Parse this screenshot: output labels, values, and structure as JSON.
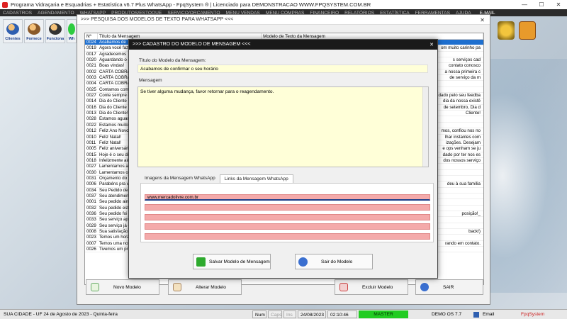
{
  "app": {
    "title": "Programa Vidraçaria e Esquadrias + Estatística v6.7 Plus WhatsApp - FpqSystem ® | Licenciado para  DEMONSTRACAO WWW.FPQSYSTEM.COM.BR",
    "controls": [
      "—",
      "☐",
      "✕"
    ]
  },
  "menu": {
    "items": [
      "CADASTROS",
      "AGENDAMENTO",
      "WHATSAPP",
      "PRODUTOS/ESTOQUE",
      "SERVIÇO/ORÇAMENTO",
      "MENU VENDAS",
      "MENU COMPRAS",
      "FINANCEIRO",
      "RELATÓRIOS",
      "ESTATÍSTICA",
      "FERRAMENTAS",
      "AJUDA"
    ],
    "email": "E-MAIL"
  },
  "toolbar": {
    "buttons": [
      {
        "label": "Clientes",
        "icon": "clients-icon"
      },
      {
        "label": "Fornece",
        "icon": "suppliers-icon"
      },
      {
        "label": "Funciona",
        "icon": "employees-icon"
      },
      {
        "label": "Wh",
        "icon": "whatsapp-icon"
      }
    ]
  },
  "search_window": {
    "title": ">>> PESQUISA DOS MODELOS DE TEXTO PARA WHATSAPP <<<",
    "close": "✕",
    "columns": [
      "Nº",
      "Título da Mensagem",
      "Modelo de Texto da Mensagem"
    ],
    "rows": [
      {
        "n": "0024",
        "title": "Acabamos de",
        "text": "",
        "selected": true
      },
      {
        "n": "0019",
        "title": "Agora você faz",
        "text": "om muito carinho pa"
      },
      {
        "n": "0017",
        "title": "Agradecemos",
        "text": ""
      },
      {
        "n": "0020",
        "title": "Aguardando o s",
        "text": "s serviços cad"
      },
      {
        "n": "0021",
        "title": "Boas vindas!",
        "text": "contato conosco"
      },
      {
        "n": "0002",
        "title": "CARTA COBRAN",
        "text": "a nossa primeira c"
      },
      {
        "n": "0003",
        "title": "CARTA COBRAN",
        "text": "de serviço da m"
      },
      {
        "n": "0004",
        "title": "CARTA COBRAN",
        "text": ""
      },
      {
        "n": "0025",
        "title": "Contamos com",
        "text": ""
      },
      {
        "n": "0027",
        "title": "Conte sempre c",
        "text": "dado pelo seu feedba"
      },
      {
        "n": "0014",
        "title": "Dia do Cliente",
        "text": "dia da nossa existê"
      },
      {
        "n": "0016",
        "title": "Dia do Cliente",
        "text": "de setembro, Dia d"
      },
      {
        "n": "0013",
        "title": "Dia do Cliente!",
        "text": "Cliente!"
      },
      {
        "n": "0028",
        "title": "Estamos aguard",
        "text": ""
      },
      {
        "n": "0022",
        "title": "Estamos muito f",
        "text": ""
      },
      {
        "n": "0012",
        "title": "Feliz Ano Novo!",
        "text": "mos, confiou nos no"
      },
      {
        "n": "0010",
        "title": "Feliz Natal!",
        "text": "lhar instantes com"
      },
      {
        "n": "0011",
        "title": "Feliz Natal!",
        "text": "izações. Desejam"
      },
      {
        "n": "0005",
        "title": "Feliz aniversário",
        "text": "e ops venham se ju"
      },
      {
        "n": "0015",
        "title": "Hoje é o seu di",
        "text": "dado por ter nos es"
      },
      {
        "n": "0018",
        "title": "Infelizmente ainc",
        "text": "dos nossos serviço"
      },
      {
        "n": "0027",
        "title": "Lamentamos a s",
        "text": ""
      },
      {
        "n": "0030",
        "title": "Lamentamos o d",
        "text": ""
      },
      {
        "n": "0031",
        "title": "Orçamento do s",
        "text": ""
      },
      {
        "n": "0006",
        "title": "Parabéns pra vo",
        "text": "deu à sua família"
      },
      {
        "n": "0034",
        "title": "Seu Pedido de V",
        "text": ""
      },
      {
        "n": "0037",
        "title": "Seu atendiment",
        "text": ""
      },
      {
        "n": "0001",
        "title": "Seu pedido ainc",
        "text": ""
      },
      {
        "n": "0032",
        "title": "Seu pedido está",
        "text": ""
      },
      {
        "n": "0036",
        "title": "Seu pedido foi D",
        "text": "posição!_"
      },
      {
        "n": "0033",
        "title": "Seu serviço apr",
        "text": ""
      },
      {
        "n": "0029",
        "title": "Seu serviço já e",
        "text": ""
      },
      {
        "n": "0008",
        "title": "Sua satisfação é",
        "text": "back!)"
      },
      {
        "n": "0023",
        "title": "Temos um horá",
        "text": ""
      },
      {
        "n": "0007",
        "title": "Temos uma noti",
        "text": "rando em contato."
      },
      {
        "n": "0026",
        "title": "Tivemos um pro",
        "text": ""
      }
    ],
    "buttons": {
      "novo": "Novo Modelo",
      "alterar": "Alterar Modelo",
      "excluir": "Excluir Modelo",
      "sair": "SAIR"
    }
  },
  "modal": {
    "title": ">>> CADASTRO DO MODELO DE MENSAGEM <<<",
    "close": "✕",
    "title_label": "Título do Modelo da Mensagem:",
    "title_value": "Acabamos de confirmar o seu horário",
    "message_label": "Mensagem",
    "message_value": "Se tiver alguma mudança, favor retornar para o reagendamento.",
    "tabs": [
      "Imagens da Mensagem WhatsApp",
      "Links da Mensagem WhatsApp"
    ],
    "active_tab": 1,
    "links": [
      "www.mercadolivre.com.br",
      "",
      "",
      "",
      "",
      ""
    ],
    "save_label": "Salvar Modelo de Mensagem",
    "exit_label": "Sair do Modelo"
  },
  "status": {
    "city": "SUA CIDADE - UF 24 de Agosto de 2023 - Quinta-feira",
    "num": "Num",
    "caps": "Caps",
    "ins": "Ins",
    "date": "24/08/2023",
    "time": "02:10:46",
    "master": "MASTER",
    "version": "DEMO OS 7.7",
    "email": "Email",
    "brand": "FpqSystem"
  }
}
